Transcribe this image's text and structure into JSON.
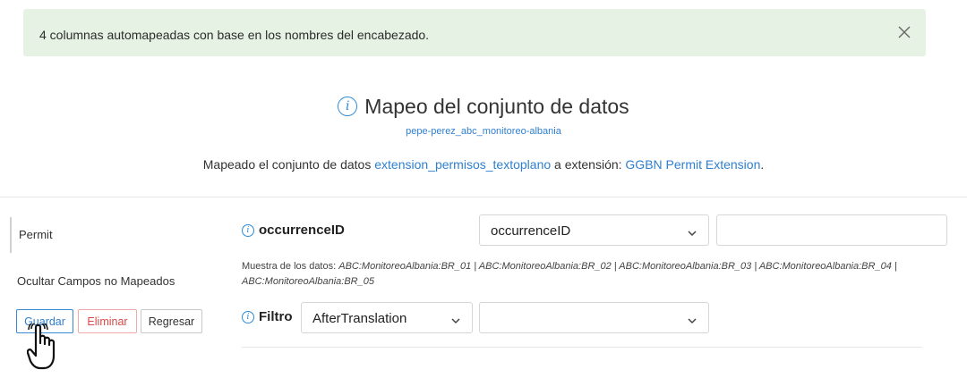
{
  "alert": {
    "message": "4 columnas automapeadas con base en los nombres del encabezado.",
    "close_icon": "close-icon",
    "background": "#e6f2e3"
  },
  "header": {
    "title": "Mapeo del conjunto de datos",
    "info_icon": "info-icon",
    "dataset_name": "pepe-perez_abc_monitoreo-albania",
    "description": {
      "prefix": "Mapeado el conjunto de datos ",
      "dataset_link": "extension_permisos_textoplano",
      "middle": " a extensión: ",
      "extension_link": "GGBN Permit Extension",
      "suffix": "."
    }
  },
  "sidebar": {
    "items": [
      {
        "label": "Permit"
      },
      {
        "label": "Ocultar Campos no Mapeados"
      }
    ],
    "buttons": {
      "save": "Guardar",
      "delete": "Eliminar",
      "back": "Regresar"
    }
  },
  "mapping": {
    "field": {
      "label": "occurrenceID",
      "selected_column": "occurrenceID",
      "default_value": ""
    },
    "sample": {
      "prefix": "Muestra de los datos: ",
      "values": "ABC:MonitoreoAlbania:BR_01 | ABC:MonitoreoAlbania:BR_02 | ABC:MonitoreoAlbania:BR_03 | ABC:MonitoreoAlbania:BR_04 | ABC:MonitoreoAlbania:BR_05"
    },
    "filter": {
      "label": "Filtro",
      "selected": "AfterTranslation",
      "value": ""
    }
  },
  "colors": {
    "accent": "#2f7fd0",
    "danger": "#d74848",
    "success_bg": "#e6f2e3"
  }
}
